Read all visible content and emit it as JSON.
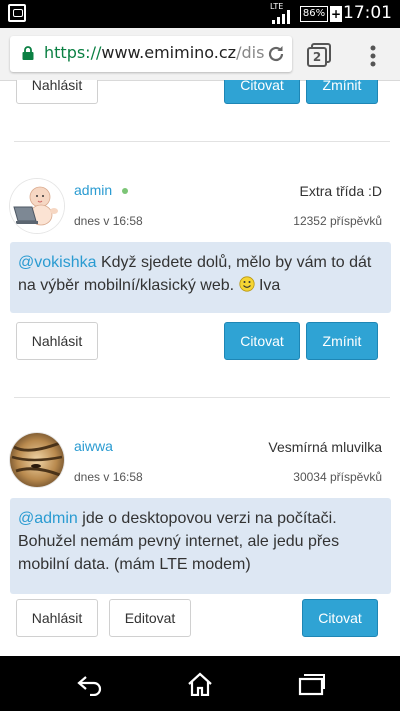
{
  "status_bar": {
    "network": "LTE",
    "battery": "86%",
    "time": "17:01"
  },
  "browser": {
    "url_scheme": "https://",
    "url_host": "www.emimino.cz",
    "url_path": "/dis",
    "tab_count": "2"
  },
  "top_actions": {
    "report_label": "Nahlásit",
    "quote_label": "Citovat",
    "mention_label": "Zmínit"
  },
  "posts": [
    {
      "username": "admin",
      "online": true,
      "rank": "Extra třída :D",
      "date": "dnes v 16:58",
      "post_count": "12352 příspěvků",
      "mention": "@vokishka",
      "text_a": " Když sjedete dolů, mělo by vám to dát na výběr mobilní/klasický web. ",
      "text_b": " Iva",
      "report_label": "Nahlásit",
      "quote_label": "Citovat",
      "mention_label": "Zmínit"
    },
    {
      "username": "aiwwa",
      "online": false,
      "rank": "Vesmírná mluvilka",
      "date": "dnes v 16:58",
      "post_count": "30034 příspěvků",
      "mention": "@admin",
      "text_a": " jde o desktopovou verzi na počítači. Bohužel nemám pevný internet, ale jedu přes mobilní data. (mám LTE modem)",
      "report_label": "Nahlásit",
      "edit_label": "Editovat",
      "quote_label": "Citovat"
    }
  ],
  "colors": {
    "accent_blue": "#2fa3d4",
    "link_blue": "#2a9bd1",
    "post_bg": "#dde7f3",
    "online_green": "#7cc576"
  }
}
